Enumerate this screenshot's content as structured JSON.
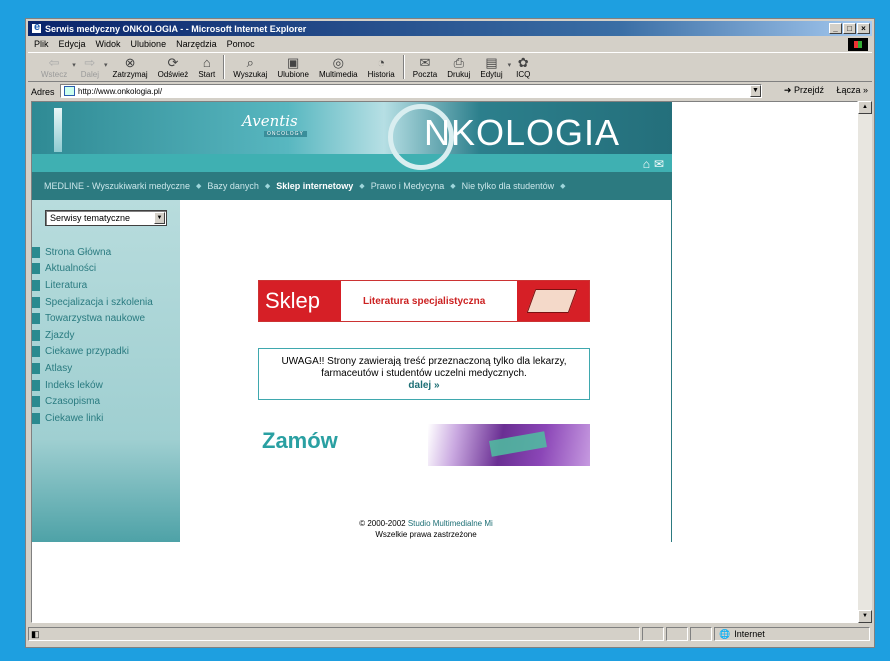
{
  "window": {
    "title": "Serwis medyczny ONKOLOGIA - - Microsoft Internet Explorer",
    "controls": [
      "_",
      "□",
      "×"
    ]
  },
  "menubar": [
    "Plik",
    "Edycja",
    "Widok",
    "Ulubione",
    "Narzędzia",
    "Pomoc"
  ],
  "toolbar": {
    "back": "Wstecz",
    "forward": "Dalej",
    "stop": "Zatrzymaj",
    "refresh": "Odśwież",
    "home": "Start",
    "search": "Wyszukaj",
    "favorites": "Ulubione",
    "media": "Multimedia",
    "history": "Historia",
    "mail": "Poczta",
    "print": "Drukuj",
    "edit": "Edytuj",
    "icq": "ICQ"
  },
  "addressbar": {
    "label": "Adres",
    "url": "http://www.onkologia.pl/",
    "go": "Przejdź",
    "links": "Łącza"
  },
  "site": {
    "aventis": "Aventis",
    "aventis_sub": "ONCOLOGY",
    "logo_text": "NKOLOGIA",
    "nav": [
      "MEDLINE - Wyszukiwarki medyczne",
      "Bazy danych",
      "Sklep internetowy",
      "Prawo i Medycyna",
      "Nie tylko dla studentów"
    ],
    "select_value": "Serwisy tematyczne",
    "menu": [
      "Strona Główna",
      "Aktualności",
      "Literatura",
      "Specjalizacja i szkolenia",
      "Towarzystwa naukowe",
      "Zjazdy",
      "Ciekawe przypadki",
      "Atlasy",
      "Indeks leków",
      "Czasopisma",
      "Ciekawe linki"
    ],
    "sklep_logo": "Sklep",
    "sklep_text": "Literatura specjalistyczna",
    "warning_text": "UWAGA!! Strony zawierają treść przeznaczoną tylko dla lekarzy, farmaceutów i studentów uczelni medycznych.",
    "warning_link": "dalej »",
    "zamow": "Zamów",
    "footer_copy": "© 2000-2002",
    "footer_link": "Studio Multimedialne Mi",
    "footer_rights": "Wszelkie prawa zastrzeżone"
  },
  "statusbar": {
    "zone": "Internet"
  },
  "colors": {
    "page_bg": "#1e9fe0",
    "title_bar": "#0a246a",
    "teal_dark": "#2c7a80",
    "teal_light": "#3fb0b2",
    "shop_red": "#d61f26"
  }
}
